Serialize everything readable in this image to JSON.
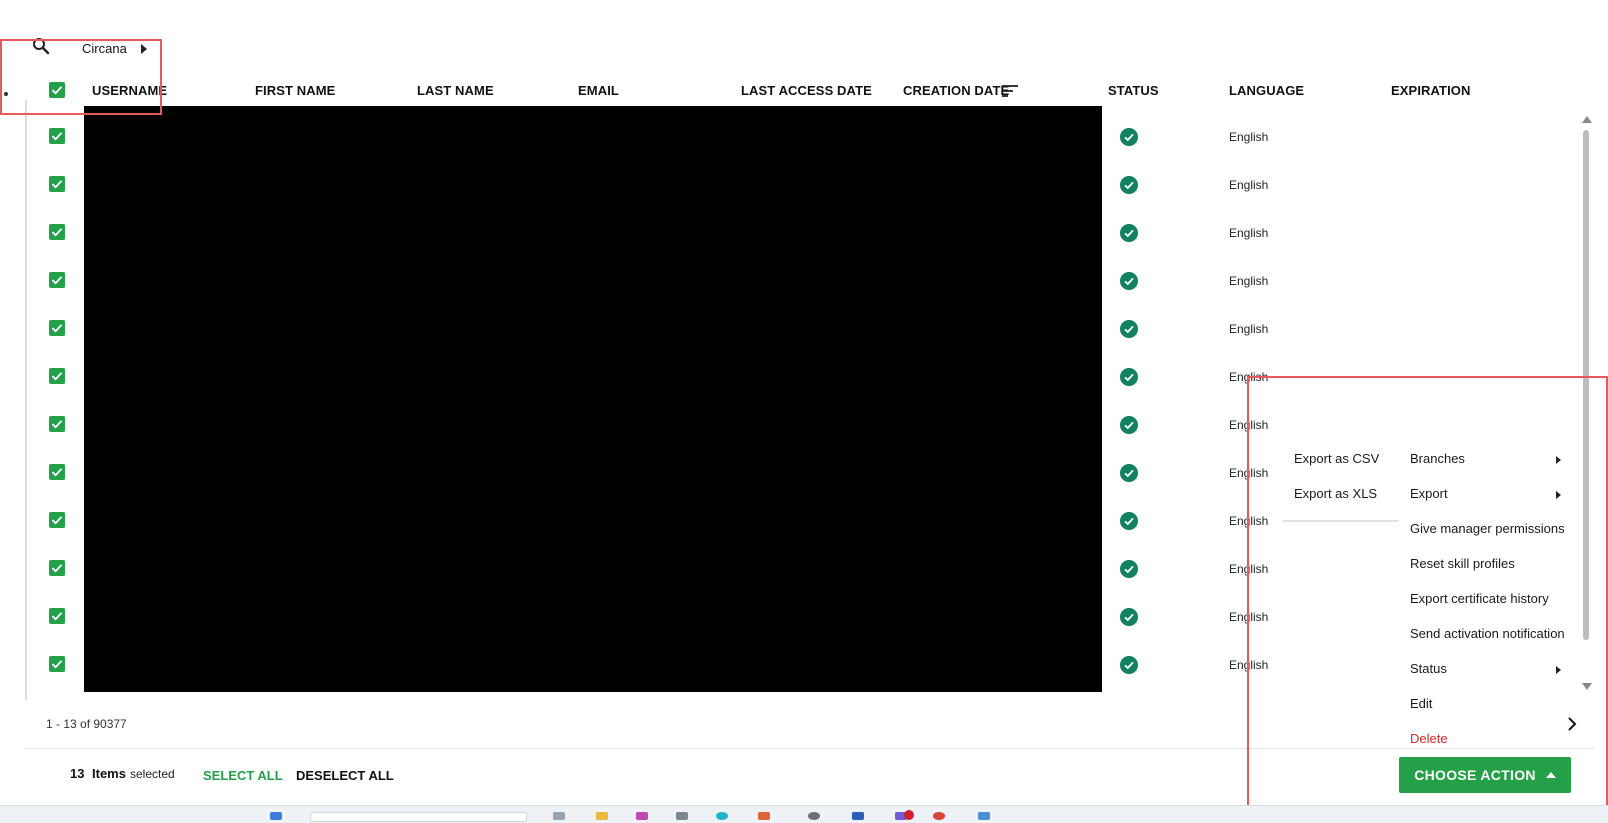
{
  "breadcrumb": {
    "label": "Circana"
  },
  "table": {
    "headers": [
      "USERNAME",
      "FIRST NAME",
      "LAST NAME",
      "EMAIL",
      "LAST ACCESS DATE",
      "CREATION DATE",
      "STATUS",
      "LANGUAGE",
      "EXPIRATION"
    ],
    "rows": [
      {
        "language": "English"
      },
      {
        "language": "English"
      },
      {
        "language": "English"
      },
      {
        "language": "English"
      },
      {
        "language": "English"
      },
      {
        "language": "English"
      },
      {
        "language": "English"
      },
      {
        "language": "English"
      },
      {
        "language": "English"
      },
      {
        "language": "English"
      },
      {
        "language": "English"
      },
      {
        "language": "English"
      }
    ]
  },
  "pager": {
    "text": "1 - 13 of 90377"
  },
  "selection": {
    "count": "13",
    "items_label": "Items",
    "selected_label": "selected",
    "select_all": "SELECT ALL",
    "deselect_all": "DESELECT ALL"
  },
  "action": {
    "button_label": "CHOOSE ACTION"
  },
  "menu": {
    "items": [
      {
        "label": "Branches"
      },
      {
        "label": "Export"
      },
      {
        "label": "Give manager permissions"
      },
      {
        "label": "Reset skill profiles"
      },
      {
        "label": "Export certificate history"
      },
      {
        "label": "Send activation notification"
      },
      {
        "label": "Status"
      },
      {
        "label": "Edit"
      },
      {
        "label": "Delete"
      }
    ]
  },
  "submenu": {
    "items": [
      {
        "label": "Export as CSV"
      },
      {
        "label": "Export as XLS"
      }
    ]
  },
  "colors": {
    "accent": "#24a148",
    "status": "#10825e",
    "danger": "#d62b2b",
    "highlight": "#e85a5a"
  }
}
